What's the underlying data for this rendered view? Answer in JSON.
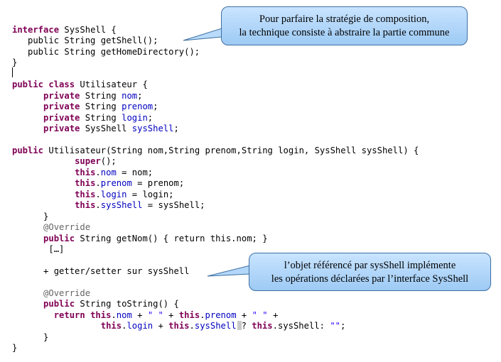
{
  "code_lines": [
    [
      {
        "t": "interface",
        "c": "kw"
      },
      {
        "t": " SysShell {"
      }
    ],
    [
      {
        "t": "   public String getShell();"
      }
    ],
    [
      {
        "t": "   public String getHomeDirectory();"
      }
    ],
    [
      {
        "t": "}"
      }
    ],
    [],
    [
      {
        "t": "public",
        "c": "kw"
      },
      {
        "t": " "
      },
      {
        "t": "class",
        "c": "kw"
      },
      {
        "t": " Utilisateur {"
      }
    ],
    [
      {
        "t": "      "
      },
      {
        "t": "private",
        "c": "kw"
      },
      {
        "t": " String "
      },
      {
        "t": "nom",
        "c": "fld"
      },
      {
        "t": ";"
      }
    ],
    [
      {
        "t": "      "
      },
      {
        "t": "private",
        "c": "kw"
      },
      {
        "t": " String "
      },
      {
        "t": "prenom",
        "c": "fld"
      },
      {
        "t": ";"
      }
    ],
    [
      {
        "t": "      "
      },
      {
        "t": "private",
        "c": "kw"
      },
      {
        "t": " String "
      },
      {
        "t": "login",
        "c": "fld"
      },
      {
        "t": ";"
      }
    ],
    [
      {
        "t": "      "
      },
      {
        "t": "private",
        "c": "kw"
      },
      {
        "t": " SysShell "
      },
      {
        "t": "sysShell",
        "c": "fld"
      },
      {
        "t": ";"
      }
    ],
    [],
    [
      {
        "t": "public",
        "c": "kw"
      },
      {
        "t": " Utilisateur(String nom,String prenom,String login, SysShell sysShell) {"
      }
    ],
    [
      {
        "t": "            "
      },
      {
        "t": "super",
        "c": "kw"
      },
      {
        "t": "();"
      }
    ],
    [
      {
        "t": "            "
      },
      {
        "t": "this",
        "c": "kw"
      },
      {
        "t": "."
      },
      {
        "t": "nom",
        "c": "fld"
      },
      {
        "t": " = nom;"
      }
    ],
    [
      {
        "t": "            "
      },
      {
        "t": "this",
        "c": "kw"
      },
      {
        "t": "."
      },
      {
        "t": "prenom",
        "c": "fld"
      },
      {
        "t": " = prenom;"
      }
    ],
    [
      {
        "t": "            "
      },
      {
        "t": "this",
        "c": "kw"
      },
      {
        "t": "."
      },
      {
        "t": "login",
        "c": "fld"
      },
      {
        "t": " = login;"
      }
    ],
    [
      {
        "t": "            "
      },
      {
        "t": "this",
        "c": "kw"
      },
      {
        "t": "."
      },
      {
        "t": "sysShell",
        "c": "fld"
      },
      {
        "t": " = sysShell;"
      }
    ],
    [
      {
        "t": "      }"
      }
    ],
    [
      {
        "t": "      "
      },
      {
        "t": "@Override",
        "c": "ann"
      }
    ],
    [
      {
        "t": "      "
      },
      {
        "t": "public",
        "c": "kw"
      },
      {
        "t": " String getNom() { return this.nom; }"
      }
    ],
    [
      {
        "t": "       […]"
      }
    ],
    [],
    [
      {
        "t": "      + getter/setter sur sysShell"
      }
    ],
    [],
    [
      {
        "t": "      "
      },
      {
        "t": "@Override",
        "c": "ann"
      }
    ],
    [
      {
        "t": "      "
      },
      {
        "t": "public",
        "c": "kw"
      },
      {
        "t": " String toString() {"
      }
    ],
    [
      {
        "t": "        "
      },
      {
        "t": "return",
        "c": "kw"
      },
      {
        "t": " "
      },
      {
        "t": "this",
        "c": "kw"
      },
      {
        "t": "."
      },
      {
        "t": "nom",
        "c": "fld"
      },
      {
        "t": " + "
      },
      {
        "t": "\" \"",
        "c": "str"
      },
      {
        "t": " + "
      },
      {
        "t": "this",
        "c": "kw"
      },
      {
        "t": "."
      },
      {
        "t": "prenom",
        "c": "fld"
      },
      {
        "t": " + "
      },
      {
        "t": "\" \"",
        "c": "str"
      },
      {
        "t": " +"
      }
    ],
    [
      {
        "t": "                 "
      },
      {
        "t": "this",
        "c": "kw"
      },
      {
        "t": "."
      },
      {
        "t": "login",
        "c": "fld"
      },
      {
        "t": " + "
      },
      {
        "t": "this",
        "c": "kw"
      },
      {
        "t": "."
      },
      {
        "t": "sysShell",
        "c": "fld"
      },
      {
        "t": "",
        "c": "cursor-mark"
      },
      {
        "t": "? "
      },
      {
        "t": "this",
        "c": "kw"
      },
      {
        "t": ".sysShell: "
      },
      {
        "t": "\"\"",
        "c": "str"
      },
      {
        "t": ";"
      }
    ],
    [
      {
        "t": "      }"
      }
    ],
    [
      {
        "t": "}"
      }
    ]
  ],
  "callouts": {
    "top": {
      "line1": "Pour parfaire la stratégie de composition,",
      "line2": "la technique consiste à abstraire la partie commune"
    },
    "bottom": {
      "line1": "l’objet référencé par sysShell implémente",
      "line2": "les opérations déclarées par l’interface SysShell"
    }
  },
  "colors": {
    "keyword": "#7f0055",
    "field": "#0000c0",
    "string": "#2a00ff",
    "annotation": "#646464",
    "callout_fill_top": "#c9e4ff",
    "callout_fill_bottom": "#9dcaf4",
    "callout_border": "#3d6fa3"
  }
}
